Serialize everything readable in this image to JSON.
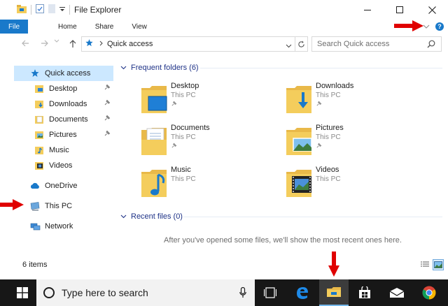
{
  "window": {
    "title": "File Explorer"
  },
  "ribbon": {
    "file_tab": "File",
    "tabs": [
      "Home",
      "Share",
      "View"
    ]
  },
  "address_bar": {
    "location": "Quick access",
    "search_placeholder": "Search Quick access"
  },
  "nav_pane": {
    "quick_access_label": "Quick access",
    "quick_access_items": [
      {
        "label": "Desktop",
        "icon": "desktop-folder-icon",
        "pinned": true
      },
      {
        "label": "Downloads",
        "icon": "downloads-folder-icon",
        "pinned": true
      },
      {
        "label": "Documents",
        "icon": "documents-folder-icon",
        "pinned": true
      },
      {
        "label": "Pictures",
        "icon": "pictures-folder-icon",
        "pinned": true
      },
      {
        "label": "Music",
        "icon": "music-folder-icon",
        "pinned": false
      },
      {
        "label": "Videos",
        "icon": "videos-folder-icon",
        "pinned": false
      }
    ],
    "onedrive_label": "OneDrive",
    "thispc_label": "This PC",
    "network_label": "Network"
  },
  "content": {
    "frequent_header": "Frequent folders (6)",
    "folders": [
      {
        "name": "Desktop",
        "location": "This PC",
        "pinned": true,
        "icon": "desktop-folder-icon"
      },
      {
        "name": "Downloads",
        "location": "This PC",
        "pinned": true,
        "icon": "downloads-folder-icon"
      },
      {
        "name": "Documents",
        "location": "This PC",
        "pinned": true,
        "icon": "documents-folder-icon"
      },
      {
        "name": "Pictures",
        "location": "This PC",
        "pinned": true,
        "icon": "pictures-folder-icon"
      },
      {
        "name": "Music",
        "location": "This PC",
        "pinned": false,
        "icon": "music-folder-icon"
      },
      {
        "name": "Videos",
        "location": "This PC",
        "pinned": false,
        "icon": "videos-folder-icon"
      }
    ],
    "recent_header": "Recent files (0)",
    "empty_message": "After you've opened some files, we'll show the most recent ones here."
  },
  "status_bar": {
    "item_count": "6 items"
  },
  "taskbar": {
    "search_placeholder": "Type here to search",
    "apps": [
      "task-view-icon",
      "edge-icon",
      "file-explorer-icon",
      "store-icon",
      "mail-icon",
      "chrome-icon"
    ],
    "active_app": "file-explorer-icon"
  },
  "colors": {
    "accent": "#1979ca",
    "selection": "#cce8ff",
    "group_header": "#1e3287",
    "folder_yellow": "#f4cd5c",
    "annotation_red": "#e00000",
    "taskbar": "#171717"
  }
}
